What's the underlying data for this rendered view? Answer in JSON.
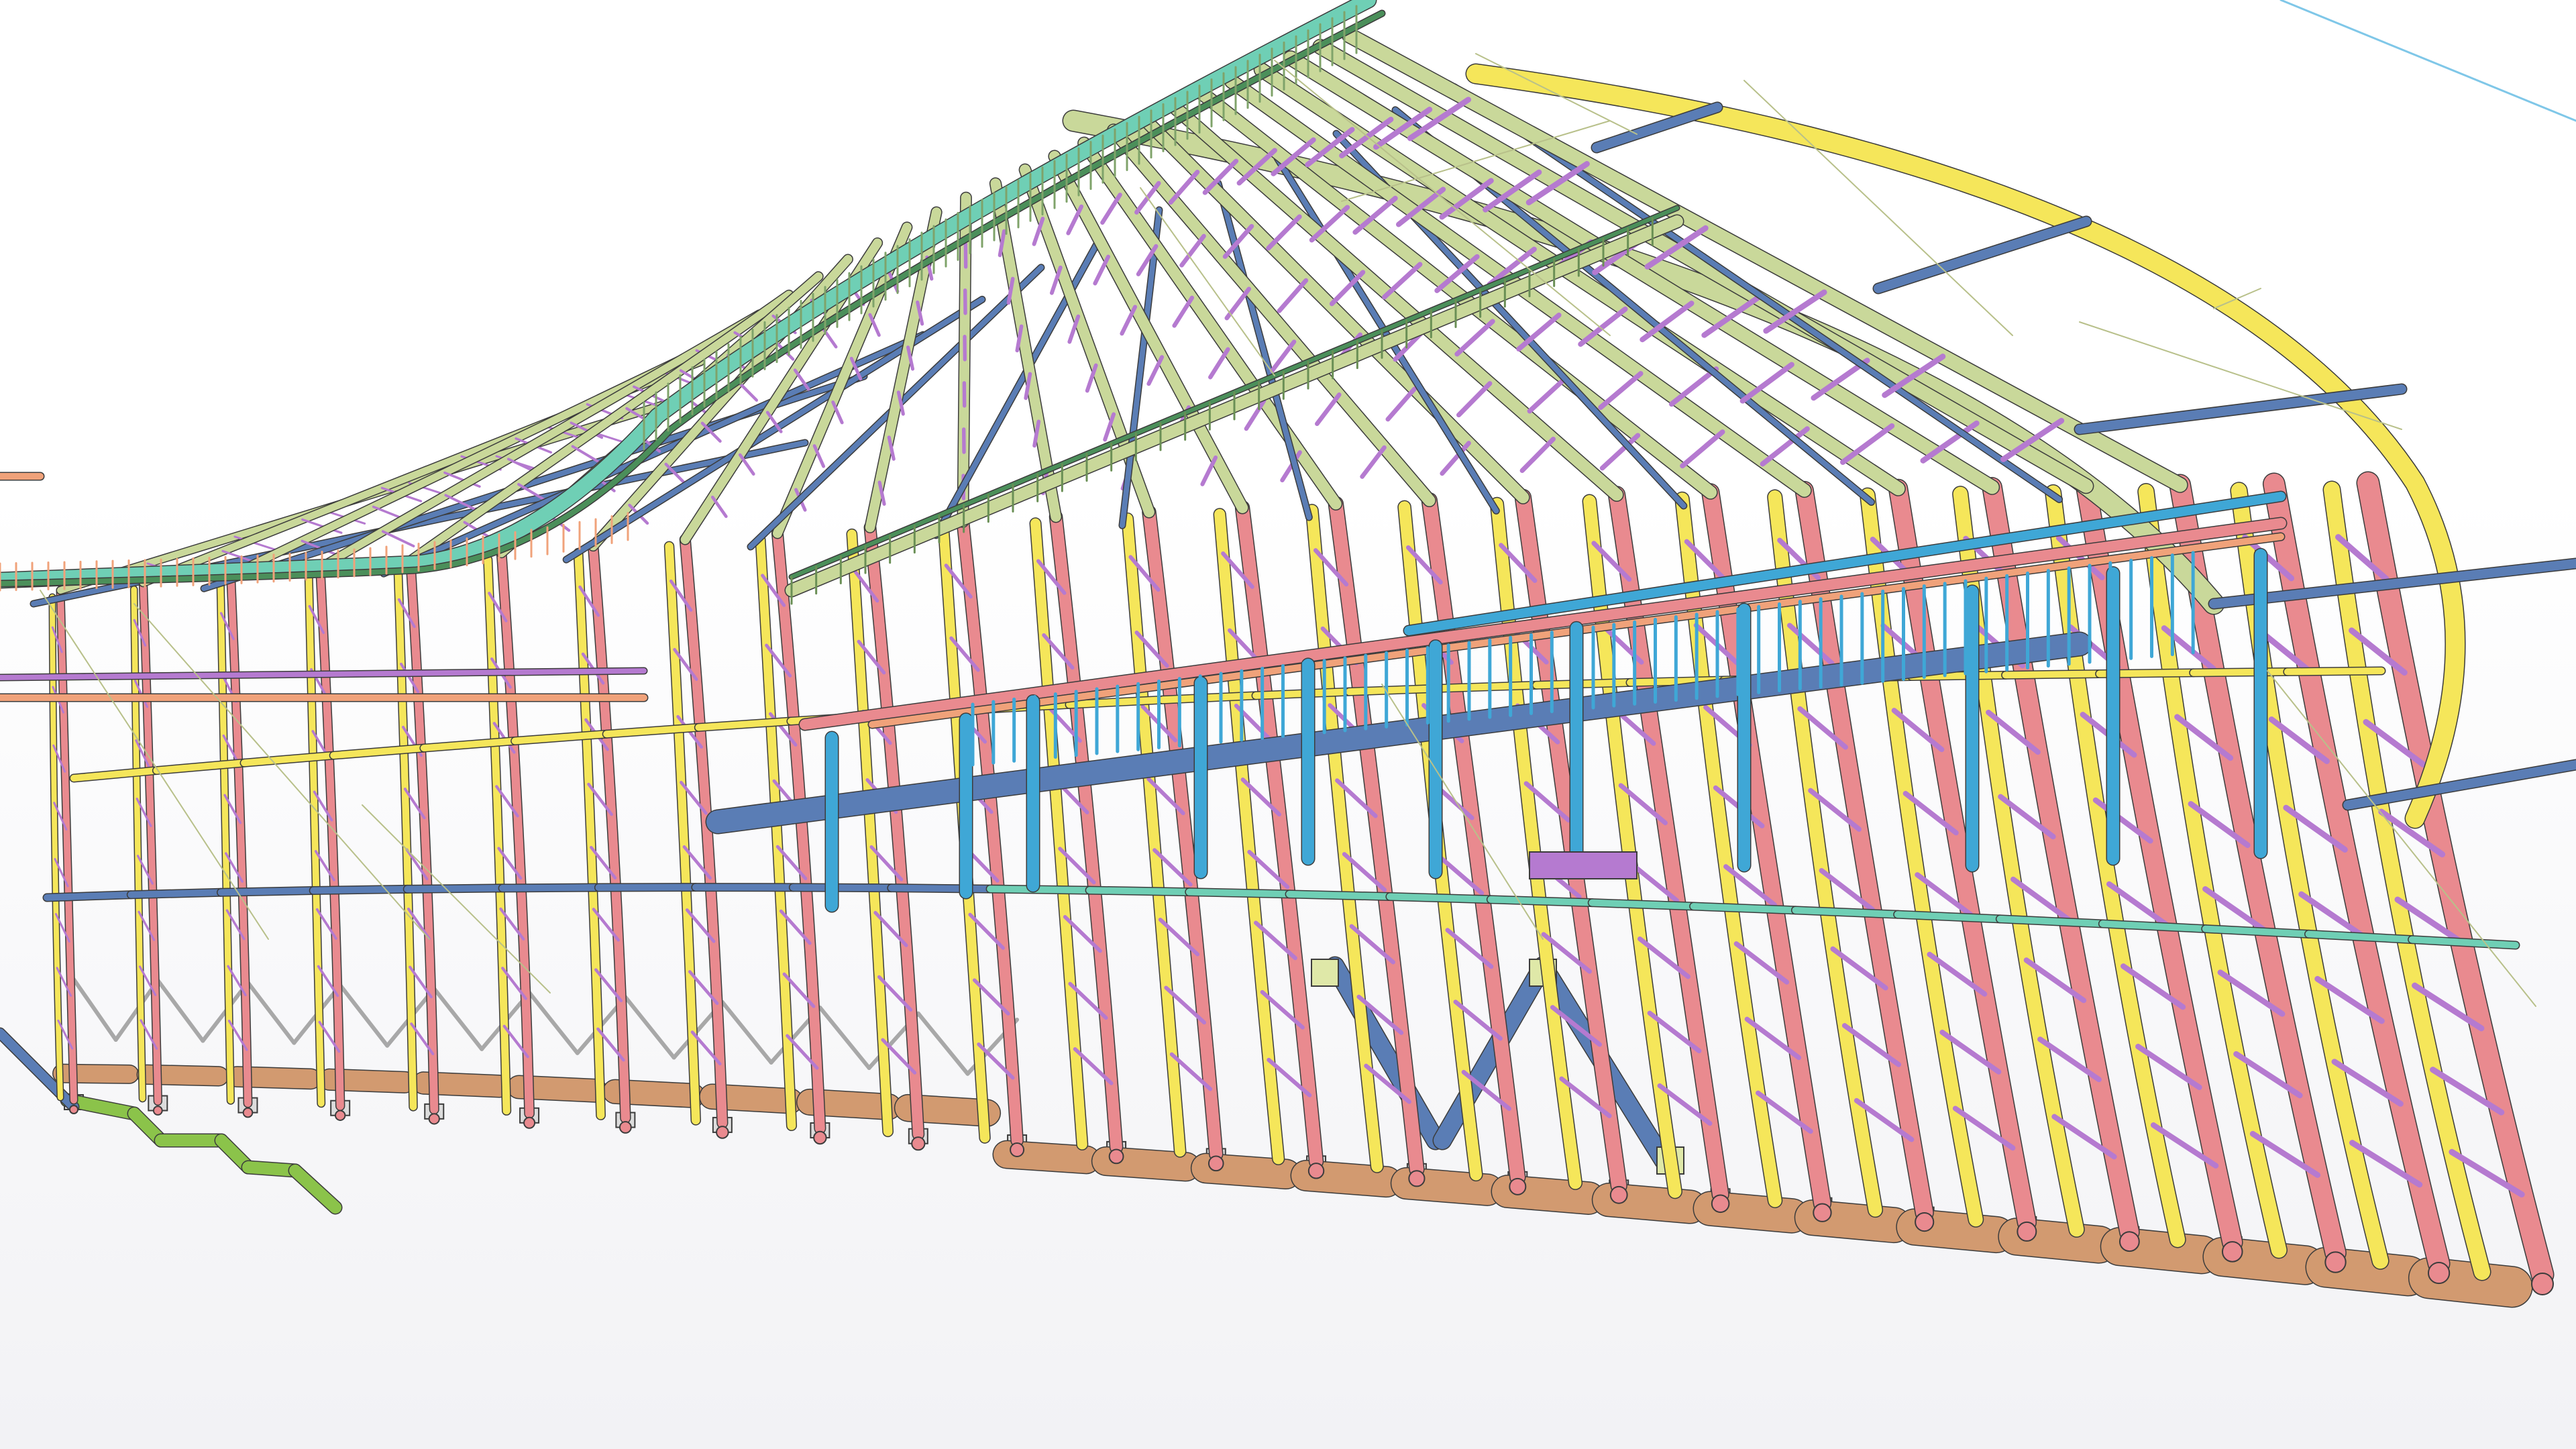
{
  "viewport": {
    "background_top": "#ffffff",
    "background_bottom": "#f2f2f5"
  },
  "palette": {
    "main_arch_pink": "#e98a8f",
    "arch_yellow": "#f5e65a",
    "lattice_purple": "#b57ad0",
    "roof_sage": "#c9d89a",
    "beam_blue": "#5a7db5",
    "column_cyan": "#3fa7d6",
    "rail_orange": "#f0a27a",
    "ring_teal": "#6fcfb5",
    "foundation_tan": "#d29a70",
    "stair_green": "#8bc34a",
    "bracing_grey": "#a8a8a8",
    "leader_line": "#b8c08a",
    "edge_dark": "#3c3c3c"
  }
}
